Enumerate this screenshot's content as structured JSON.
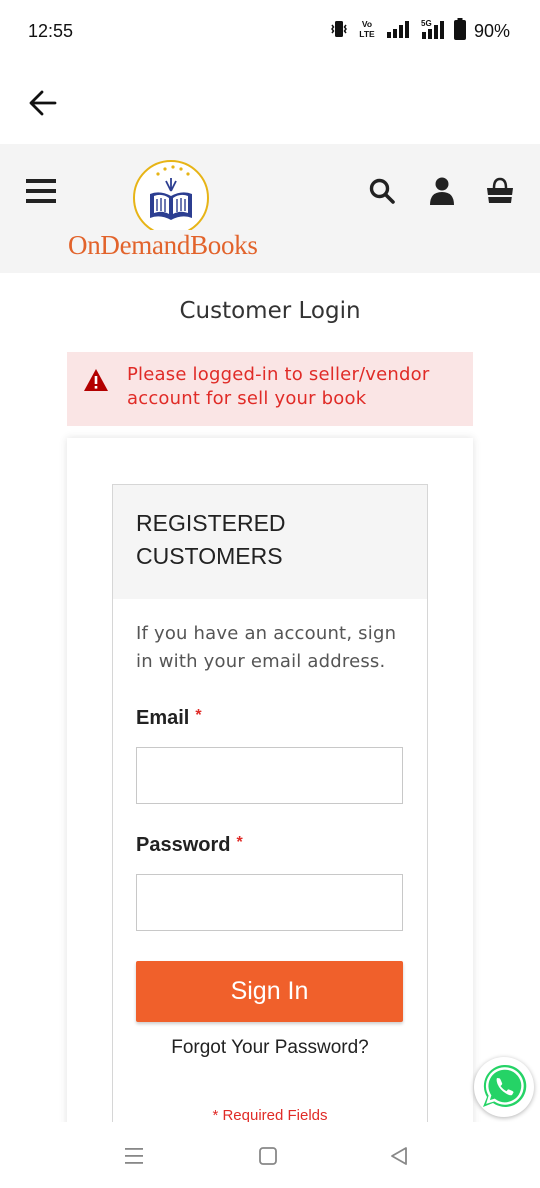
{
  "status_bar": {
    "time": "12:55",
    "battery_percent": "90%",
    "network_labels": [
      "Vo LTE",
      "5G"
    ],
    "icons": [
      "vibrate-icon",
      "volte-icon",
      "signal-icon",
      "5g-signal-icon",
      "battery-icon"
    ]
  },
  "app_bar": {
    "back_icon": "arrow-left-icon"
  },
  "header": {
    "logo_text": "OnDemandBooks",
    "icons": [
      "hamburger-menu-icon",
      "search-icon",
      "account-icon",
      "cart-icon"
    ]
  },
  "main": {
    "page_title": "Customer Login",
    "alert_text": "Please logged-in to seller/vendor account for sell your book",
    "block_title": "REGISTERED CUSTOMERS",
    "block_text": "If you have an account, sign in with your email address.",
    "email_label": "Email",
    "email_value": "",
    "password_label": "Password",
    "password_value": "",
    "required_mark": "*",
    "signin_label": "Sign In",
    "forgot_label": "Forgot Your Password?",
    "required_fields_note": "* Required Fields"
  },
  "colors": {
    "accent": "#f0602b",
    "logo_orange": "#e2632b",
    "error_red": "#e02b27",
    "alert_bg": "#fae5e5",
    "logo_blue": "#2c3e91",
    "logo_gold": "#e7b416",
    "whatsapp_green": "#25d366"
  },
  "floating": {
    "whatsapp_icon": "whatsapp-icon"
  },
  "nav_bar": {
    "icons": [
      "recent-apps-icon",
      "home-icon",
      "back-triangle-icon"
    ]
  }
}
